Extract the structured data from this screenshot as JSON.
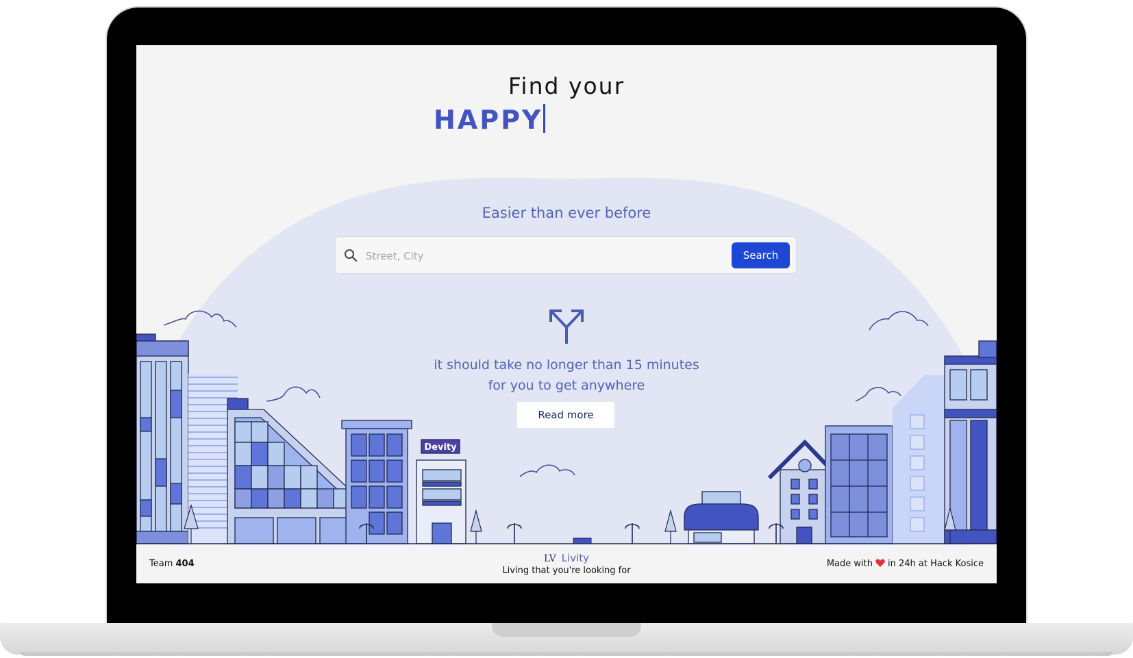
{
  "hero": {
    "title_line1": "Find your",
    "title_word": "HAPPY"
  },
  "search": {
    "subtitle": "Easier than ever before",
    "placeholder": "Street, City",
    "button_label": "Search"
  },
  "info": {
    "line1": "it should take no longer than 15 minutes",
    "line2": "for you to get anywhere",
    "read_more_label": "Read more"
  },
  "illustration": {
    "shop_sign": "Devity"
  },
  "footer": {
    "team_prefix": "Team",
    "team_number": "404",
    "logo_mark": "LV",
    "logo_name": "Livity",
    "tagline": "Living that you're looking for",
    "made_with_prefix": "Made with",
    "made_with_suffix": "in 24h at Hack Kosice"
  },
  "colors": {
    "accent": "#1e47d4",
    "primary_text": "#4354c1",
    "dome": "#e2e6f4",
    "background": "#f4f4f4"
  },
  "icons": {
    "search": "search-icon",
    "split": "split-arrow-icon",
    "heart": "heart-icon"
  }
}
